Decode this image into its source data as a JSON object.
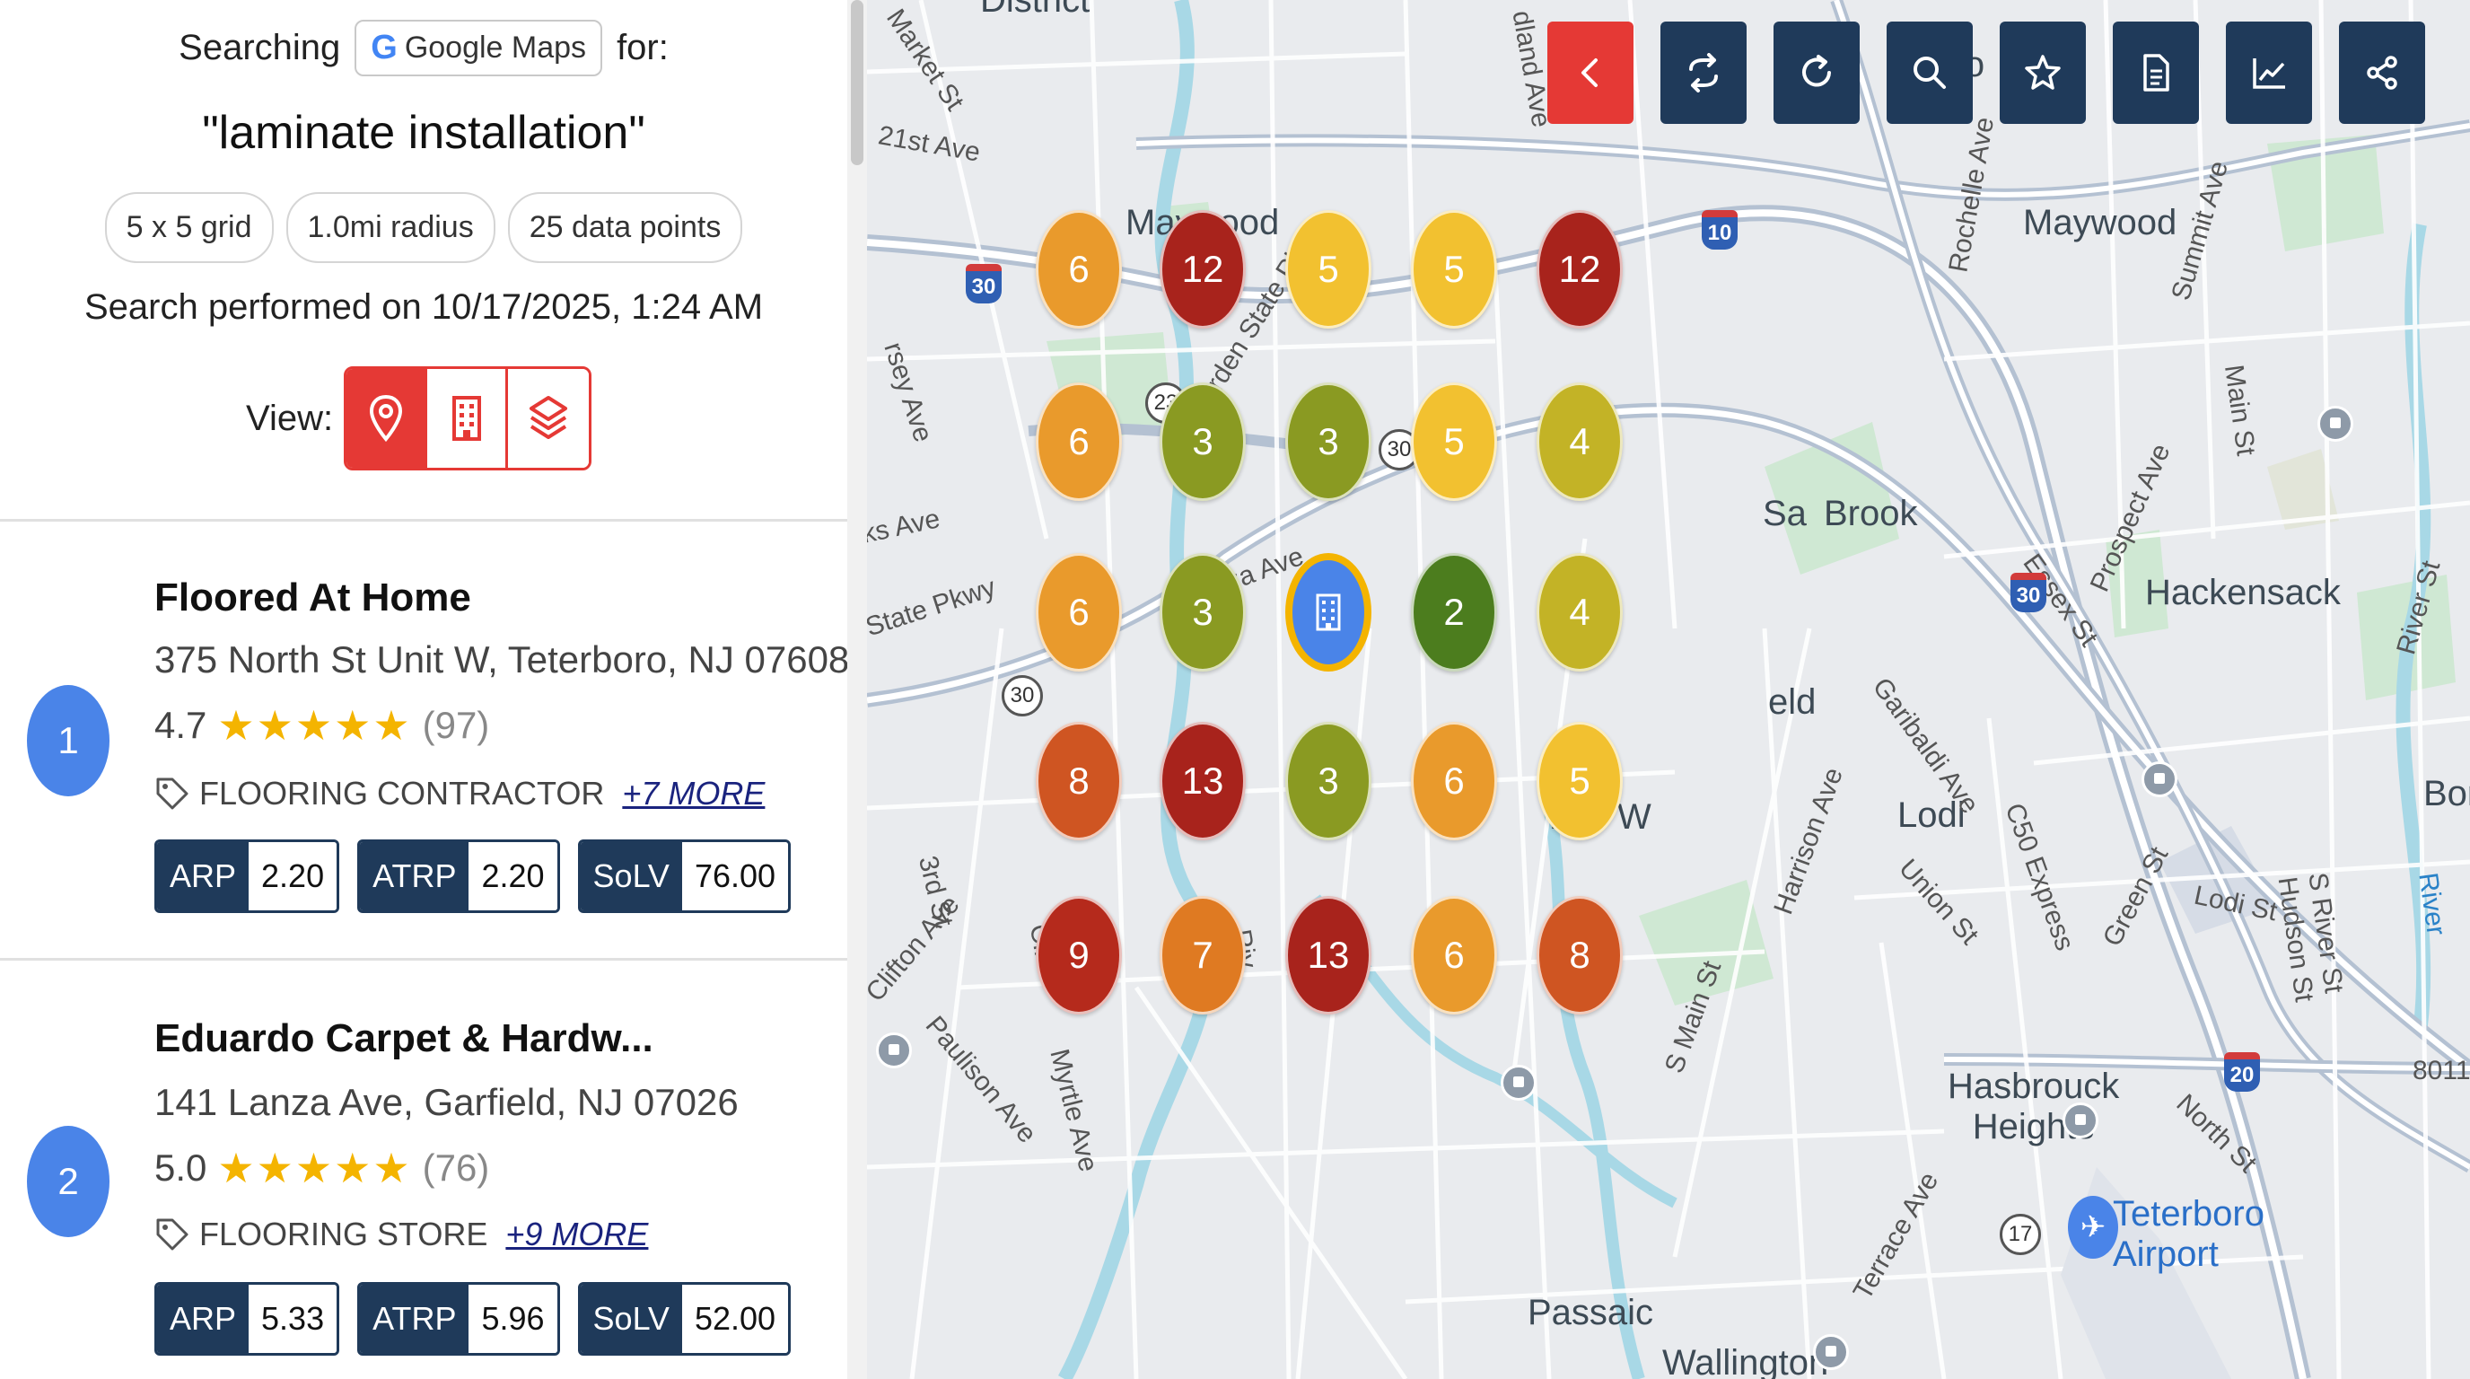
{
  "search": {
    "prefix": "Searching",
    "engine": "Google Maps",
    "suffix": "for:",
    "query": "\"laminate installation\"",
    "grid": "5 x 5 grid",
    "radius": "1.0mi radius",
    "points": "25 data points",
    "performed": "Search performed on 10/17/2025, 1:24 AM"
  },
  "view": {
    "label": "View:",
    "options": [
      {
        "icon": "map-pin-icon",
        "active": true
      },
      {
        "icon": "building-icon",
        "active": false
      },
      {
        "icon": "layers-icon",
        "active": false
      }
    ]
  },
  "results": [
    {
      "rank": "1",
      "name": "Floored At Home",
      "address": "375 North St Unit W, Teterboro, NJ 07608",
      "rating": "4.7",
      "stars": 4.7,
      "reviews": "(97)",
      "category": "FLOORING CONTRACTOR",
      "more": "+7 MORE",
      "metrics": [
        {
          "key": "ARP",
          "value": "2.20"
        },
        {
          "key": "ATRP",
          "value": "2.20"
        },
        {
          "key": "SoLV",
          "value": "76.00"
        }
      ]
    },
    {
      "rank": "2",
      "name": "Eduardo Carpet & Hardw...",
      "address": "141 Lanza Ave, Garfield, NJ 07026",
      "rating": "5.0",
      "stars": 5.0,
      "reviews": "(76)",
      "category": "FLOORING STORE",
      "more": "+9 MORE",
      "metrics": [
        {
          "key": "ARP",
          "value": "5.33"
        },
        {
          "key": "ATRP",
          "value": "5.96"
        },
        {
          "key": "SoLV",
          "value": "52.00"
        }
      ]
    }
  ],
  "toolbar": [
    "chevron-left-icon",
    "swap-icon",
    "refresh-icon",
    "search-icon",
    "star-icon",
    "document-icon",
    "chart-icon",
    "share-icon"
  ],
  "grid_ranks": [
    [
      "6",
      "12",
      "5",
      "5",
      "12"
    ],
    [
      "6",
      "3",
      "3",
      "5",
      "4"
    ],
    [
      "6",
      "3",
      "center",
      "2",
      "4"
    ],
    [
      "8",
      "13",
      "3",
      "6",
      "5"
    ],
    [
      "9",
      "7",
      "13",
      "6",
      "8"
    ]
  ],
  "rank_colors": {
    "2": "#4c7d1e",
    "3": "#8a9a22",
    "4": "#c3b326",
    "5": "#f2c130",
    "6": "#e99a2c",
    "7": "#df7a22",
    "8": "#cf5522",
    "9": "#b52a1c",
    "12": "#a8231c",
    "13": "#a8231c"
  },
  "map_labels": {
    "maywood": "Maywood",
    "hackensack": "Hackensack",
    "lodi": "Lodi",
    "hasbrouck": "Hasbrouck\nHeights",
    "teterboro": "Teterboro\nAirport",
    "passaic": "Passaic",
    "wallington": "Wallington",
    "brook": "Brook",
    "bon": "Bon",
    "ro": "Ro",
    "sa": "Sa",
    "eld": "eld",
    "district": "District",
    "m": "M",
    "w": "W",
    "roads": {
      "market": "Market St",
      "st21": "21st Ave",
      "jersey": "rsey Ave",
      "ks": "ks Ave",
      "statepkwy": "State Pkwy",
      "garden": "Garden State Pkwy",
      "lanza": "Lanza Ave",
      "rochelle": "Rochelle Ave",
      "summit": "Summit Ave",
      "main": "Main St",
      "prospect": "Prospect Ave",
      "essex": "Essex St",
      "river": "River St",
      "garibaldi": "Garibaldi Ave",
      "harrison": "Harrison Ave",
      "c50": "C50 Express",
      "union": "Union St",
      "green": "Green St",
      "lodist": "Lodi St",
      "shudson": "S River St\nHudson St",
      "riverv": "River",
      "st3": "3rd St",
      "clifton": "Clifton Ave",
      "paulison": "Paulison Ave",
      "myrtle": "Myrtle Ave",
      "smain": "S Main St",
      "terrace": "Terrace Ave",
      "northst": "North St",
      "cli": "Cli",
      "riv": "Riv",
      "land": "dland Ave",
      "8011": "8011"
    },
    "shields": {
      "i30a": "30",
      "i30b": "30",
      "i10": "10",
      "i20": "20",
      "s23": "23",
      "s30a": "30",
      "s30b": "30",
      "s17": "17"
    }
  }
}
